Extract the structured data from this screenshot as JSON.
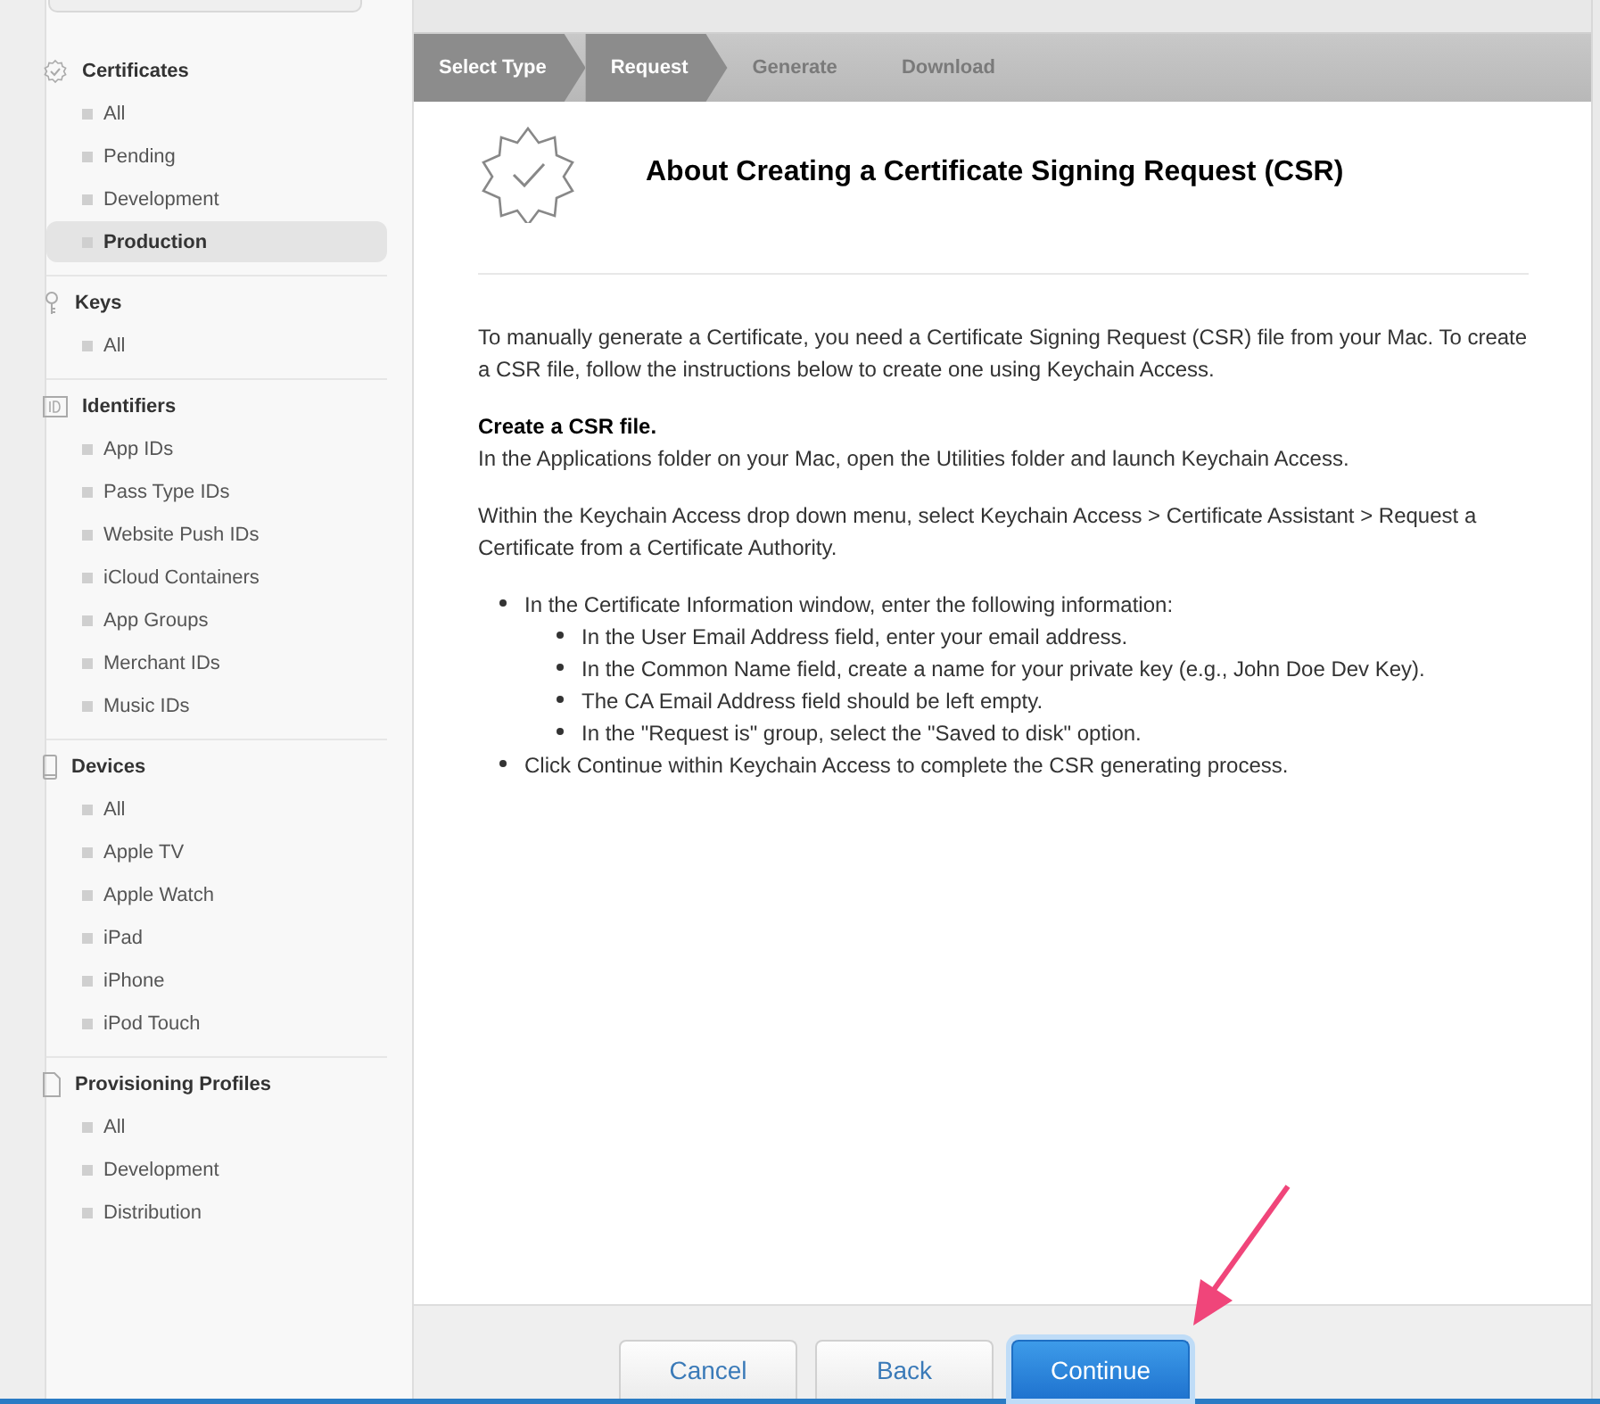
{
  "sidebar": {
    "sections": [
      {
        "title": "Certificates",
        "items": [
          {
            "label": "All",
            "selected": false
          },
          {
            "label": "Pending",
            "selected": false
          },
          {
            "label": "Development",
            "selected": false
          },
          {
            "label": "Production",
            "selected": true
          }
        ]
      },
      {
        "title": "Keys",
        "items": [
          {
            "label": "All",
            "selected": false
          }
        ]
      },
      {
        "title": "Identifiers",
        "items": [
          {
            "label": "App IDs",
            "selected": false
          },
          {
            "label": "Pass Type IDs",
            "selected": false
          },
          {
            "label": "Website Push IDs",
            "selected": false
          },
          {
            "label": "iCloud Containers",
            "selected": false
          },
          {
            "label": "App Groups",
            "selected": false
          },
          {
            "label": "Merchant IDs",
            "selected": false
          },
          {
            "label": "Music IDs",
            "selected": false
          }
        ]
      },
      {
        "title": "Devices",
        "items": [
          {
            "label": "All",
            "selected": false
          },
          {
            "label": "Apple TV",
            "selected": false
          },
          {
            "label": "Apple Watch",
            "selected": false
          },
          {
            "label": "iPad",
            "selected": false
          },
          {
            "label": "iPhone",
            "selected": false
          },
          {
            "label": "iPod Touch",
            "selected": false
          }
        ]
      },
      {
        "title": "Provisioning Profiles",
        "items": [
          {
            "label": "All",
            "selected": false
          },
          {
            "label": "Development",
            "selected": false
          },
          {
            "label": "Distribution",
            "selected": false
          }
        ]
      }
    ]
  },
  "steps": [
    {
      "label": "Select Type",
      "completed": true
    },
    {
      "label": "Request",
      "completed": true
    },
    {
      "label": "Generate",
      "completed": false
    },
    {
      "label": "Download",
      "completed": false
    }
  ],
  "title": "About Creating a Certificate Signing Request (CSR)",
  "intro": "To manually generate a Certificate, you need a Certificate Signing Request (CSR) file from your Mac. To create a CSR file, follow the instructions below to create one using Keychain Access.",
  "subheading": "Create a CSR file.",
  "paragraphs": [
    "In the Applications folder on your Mac, open the Utilities folder and launch Keychain Access.",
    "Within the Keychain Access drop down menu, select Keychain Access > Certificate Assistant > Request a Certificate from a Certificate Authority."
  ],
  "bullets": [
    {
      "text": "In the Certificate Information window, enter the following information:",
      "children": [
        {
          "text": "In the User Email Address field, enter your email address."
        },
        {
          "text": "In the Common Name field, create a name for your private key (e.g., John Doe Dev Key)."
        },
        {
          "text": "The CA Email Address field should be left empty."
        },
        {
          "text": "In the \"Request is\" group, select the \"Saved to disk\" option."
        }
      ]
    },
    {
      "text": "Click Continue within Keychain Access to complete the CSR generating process."
    }
  ],
  "buttons": [
    {
      "label": "Cancel",
      "kind": "secondary"
    },
    {
      "label": "Back",
      "kind": "secondary"
    },
    {
      "label": "Continue",
      "kind": "primary"
    }
  ]
}
